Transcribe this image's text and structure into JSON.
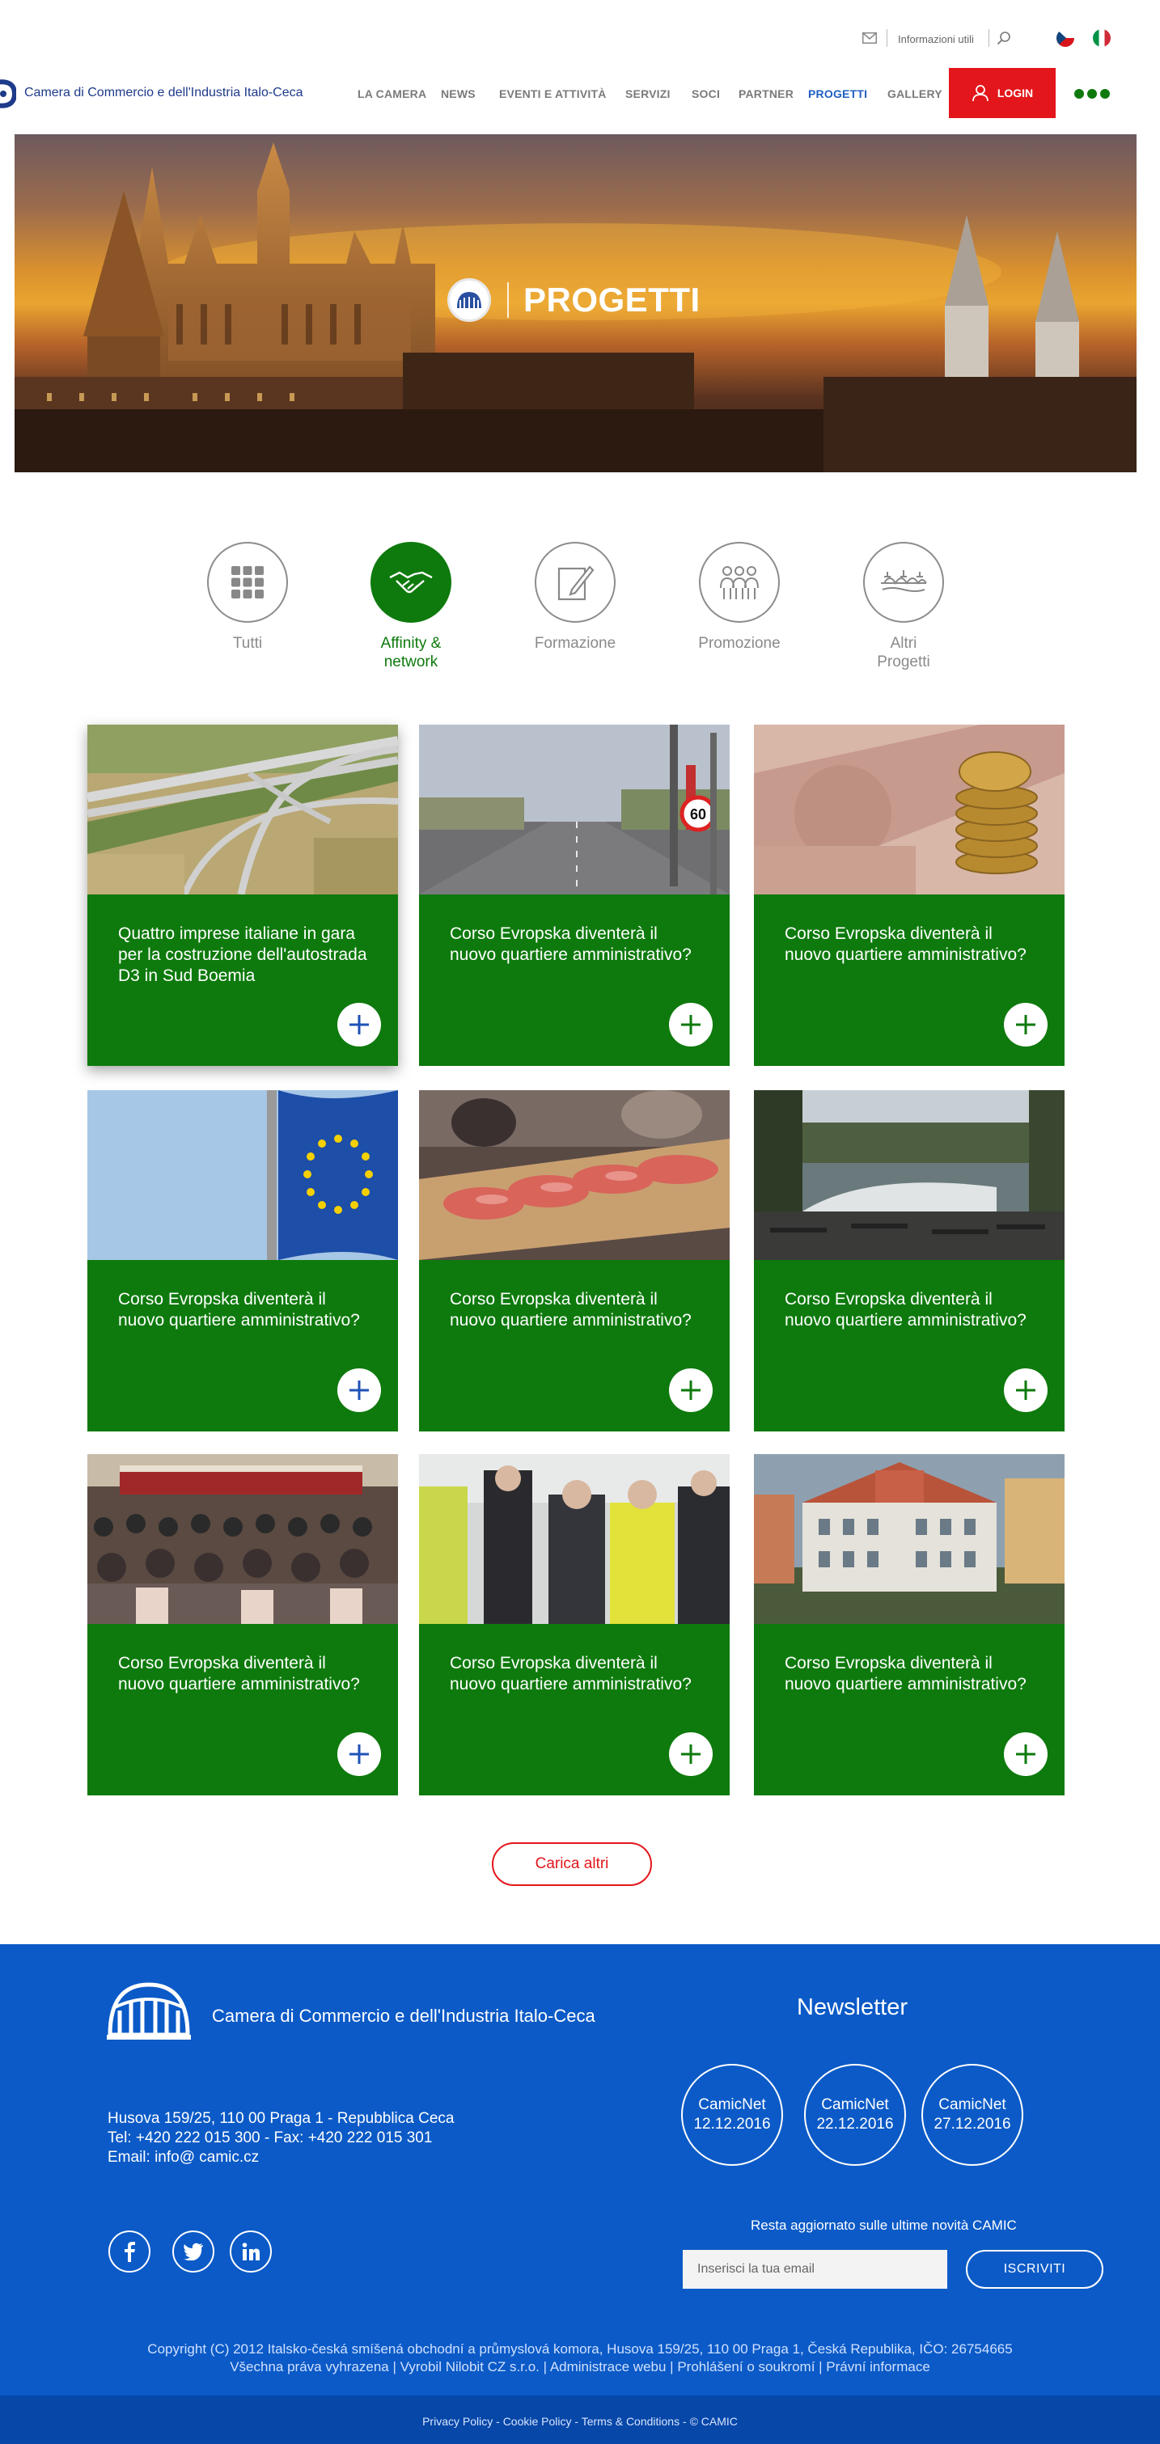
{
  "topbar": {
    "info_label": "Informazioni utili",
    "languages": [
      "cz",
      "it"
    ]
  },
  "nav": {
    "brand": "Camera di Commercio e dell'Industria Italo-Ceca",
    "items": [
      {
        "label": "LA CAMERA"
      },
      {
        "label": "NEWS"
      },
      {
        "label": "EVENTI E ATTIVITÀ"
      },
      {
        "label": "SERVIZI"
      },
      {
        "label": "SOCI"
      },
      {
        "label": "PARTNER"
      },
      {
        "label": "PROGETTI",
        "active": true
      },
      {
        "label": "GALLERY"
      }
    ],
    "login_label": "LOGIN",
    "colors": {
      "accent": "#e3161b",
      "green": "#0e7a0d",
      "active_link": "#2060c0"
    }
  },
  "hero": {
    "title": "PROGETTI"
  },
  "filters": [
    {
      "label": "Tutti",
      "icon": "grid-icon"
    },
    {
      "label": "Affinity &\nnetwork",
      "icon": "handshake-icon",
      "active": true
    },
    {
      "label": "Formazione",
      "icon": "pencil-note-icon"
    },
    {
      "label": "Promozione",
      "icon": "people-icon"
    },
    {
      "label": "Altri\nProgetti",
      "icon": "bridge-icon"
    }
  ],
  "cards": [
    {
      "title": "Quattro imprese italiane in gara per la costruzione dell'autostrada D3 in Sud Boemia",
      "image": "highway-aerial"
    },
    {
      "title": "Corso Evropska diventerà il nuovo quartiere amministrativo?",
      "image": "city-avenue"
    },
    {
      "title": "Corso Evropska diventerà il nuovo quartiere amministrativo?",
      "image": "banknotes-coins"
    },
    {
      "title": "Corso Evropska diventerà il nuovo quartiere amministrativo?",
      "image": "eu-flag"
    },
    {
      "title": "Corso Evropska diventerà il nuovo quartiere amministrativo?",
      "image": "buffet-prosciutto"
    },
    {
      "title": "Corso Evropska diventerà il nuovo quartiere amministrativo?",
      "image": "river-terrace"
    },
    {
      "title": "Corso Evropska diventerà il nuovo quartiere amministrativo?",
      "image": "conference-audience"
    },
    {
      "title": "Corso Evropska diventerà il nuovo quartiere amministrativo?",
      "image": "site-visit"
    },
    {
      "title": "Corso Evropska diventerà il nuovo quartiere amministrativo?",
      "image": "historic-building"
    }
  ],
  "load_more_label": "Carica altri",
  "footer": {
    "brand": "Camera di Commercio e dell'Industria Italo-Ceca",
    "address_line1": "Husova 159/25, 110 00 Praga 1 - Repubblica Ceca",
    "address_line2": "Tel: +420 222 015 300 - Fax: +420 222 015 301",
    "address_line3": "Email: info@ camic.cz",
    "newsletter_title": "Newsletter",
    "newsletters": [
      {
        "name": "CamicNet",
        "date": "12.12.2016"
      },
      {
        "name": "CamicNet",
        "date": "22.12.2016"
      },
      {
        "name": "CamicNet",
        "date": "27.12.2016"
      }
    ],
    "social": [
      "facebook-icon",
      "twitter-icon",
      "linkedin-icon"
    ],
    "subscribe_label": "Resta aggiornato sulle ultime novità CAMIC",
    "email_placeholder": "Inserisci la tua email",
    "subscribe_button": "ISCRIVITI",
    "copyright_line1": "Copyright (C) 2012 Italsko-česká smíšená obchodní a průmyslová komora, Husova 159/25, 110 00 Praga 1, Česká Republika, IČO: 26754665",
    "copyright_links": [
      "Všechna práva vyhrazena",
      "Vyrobil Nilobit CZ s.r.o.",
      "Administrace webu",
      "Prohlášení o soukromí",
      "Právní informace"
    ],
    "bottom_links": [
      "Privacy Policy",
      "Cookie Policy",
      "Terms & Conditions",
      "© CAMIC"
    ],
    "colors": {
      "background": "#0b5ac7",
      "bottom_bar": "#0647a8"
    }
  }
}
